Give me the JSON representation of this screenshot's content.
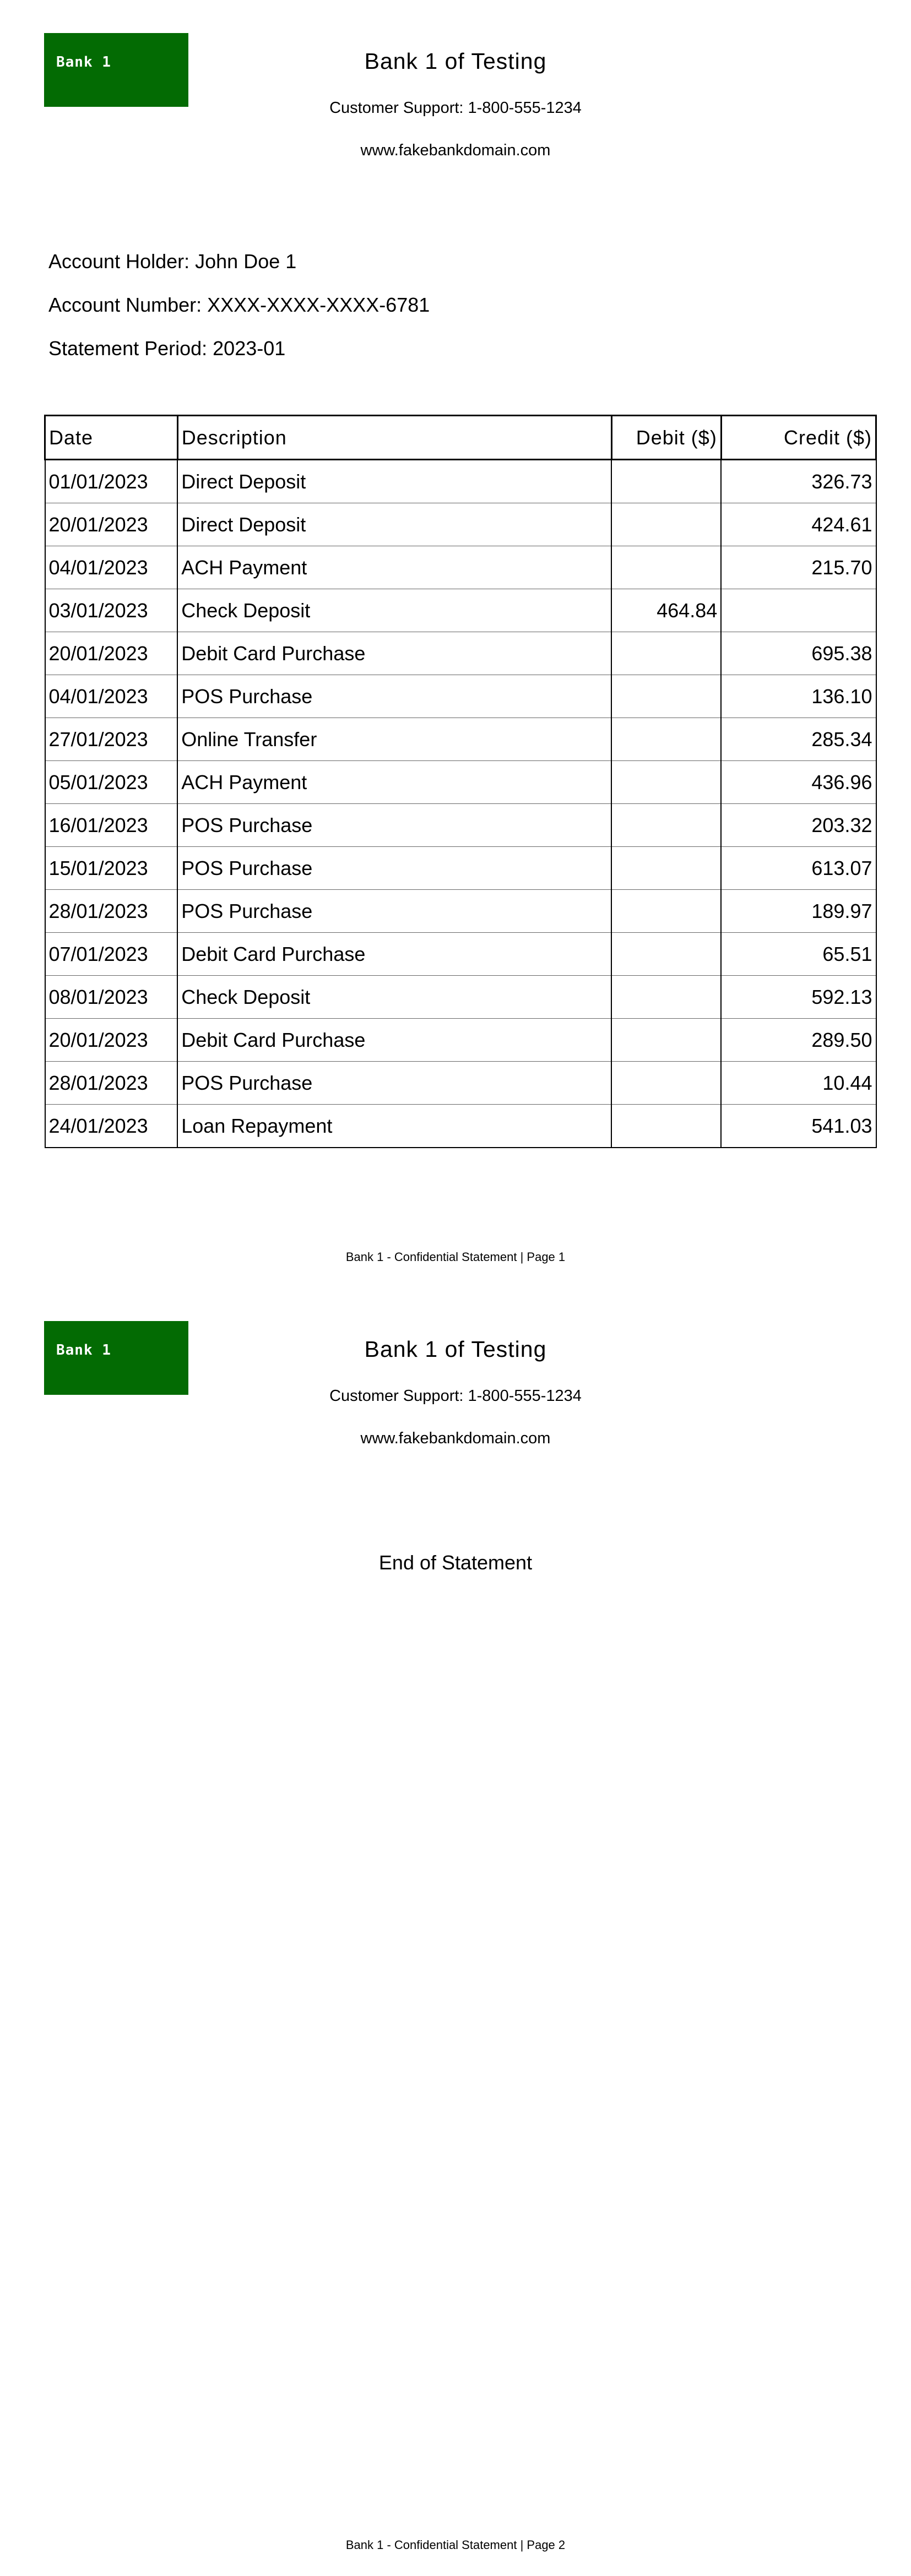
{
  "header": {
    "logo_text": "Bank 1",
    "bank_name": "Bank 1 of Testing",
    "support": "Customer Support: 1-800-555-1234",
    "website": "www.fakebankdomain.com",
    "brand_color": "#036b03"
  },
  "account": {
    "holder": "Account Holder: John Doe 1",
    "number": "Account Number: XXXX-XXXX-XXXX-6781",
    "period": "Statement Period: 2023-01"
  },
  "table": {
    "headers": [
      "Date",
      "Description",
      "Debit ($)",
      "Credit ($)"
    ],
    "rows": [
      {
        "date": "01/01/2023",
        "description": "Direct Deposit",
        "debit": "",
        "credit": "326.73"
      },
      {
        "date": "20/01/2023",
        "description": "Direct Deposit",
        "debit": "",
        "credit": "424.61"
      },
      {
        "date": "04/01/2023",
        "description": "ACH Payment",
        "debit": "",
        "credit": "215.70"
      },
      {
        "date": "03/01/2023",
        "description": "Check Deposit",
        "debit": "464.84",
        "credit": ""
      },
      {
        "date": "20/01/2023",
        "description": "Debit Card Purchase",
        "debit": "",
        "credit": "695.38"
      },
      {
        "date": "04/01/2023",
        "description": "POS Purchase",
        "debit": "",
        "credit": "136.10"
      },
      {
        "date": "27/01/2023",
        "description": "Online Transfer",
        "debit": "",
        "credit": "285.34"
      },
      {
        "date": "05/01/2023",
        "description": "ACH Payment",
        "debit": "",
        "credit": "436.96"
      },
      {
        "date": "16/01/2023",
        "description": "POS Purchase",
        "debit": "",
        "credit": "203.32"
      },
      {
        "date": "15/01/2023",
        "description": "POS Purchase",
        "debit": "",
        "credit": "613.07"
      },
      {
        "date": "28/01/2023",
        "description": "POS Purchase",
        "debit": "",
        "credit": "189.97"
      },
      {
        "date": "07/01/2023",
        "description": "Debit Card Purchase",
        "debit": "",
        "credit": "65.51"
      },
      {
        "date": "08/01/2023",
        "description": "Check Deposit",
        "debit": "",
        "credit": "592.13"
      },
      {
        "date": "20/01/2023",
        "description": "Debit Card Purchase",
        "debit": "",
        "credit": "289.50"
      },
      {
        "date": "28/01/2023",
        "description": "POS Purchase",
        "debit": "",
        "credit": "10.44"
      },
      {
        "date": "24/01/2023",
        "description": "Loan Repayment",
        "debit": "",
        "credit": "541.03"
      }
    ]
  },
  "footer": {
    "page1": "Bank 1 - Confidential Statement | Page 1",
    "page2": "Bank 1 - Confidential Statement | Page 2"
  },
  "end_text": "End of Statement"
}
